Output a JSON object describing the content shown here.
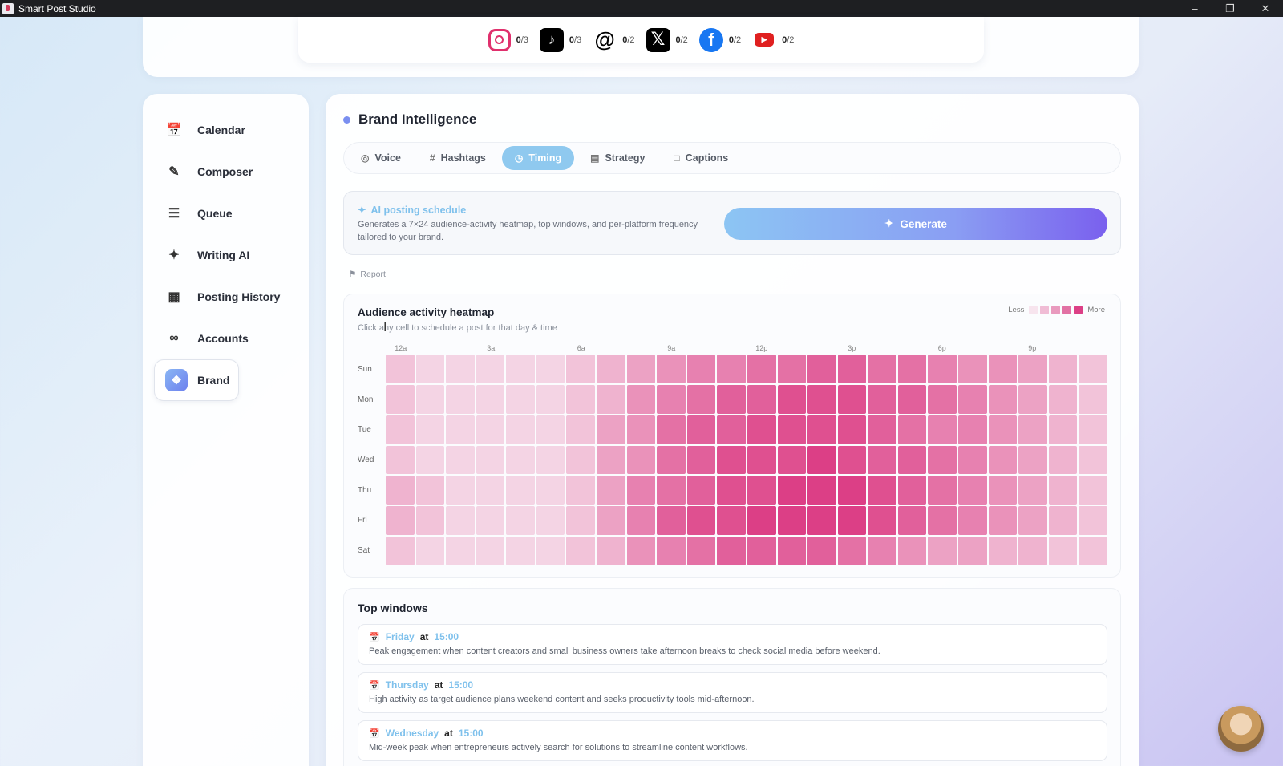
{
  "window": {
    "title": "Smart Post Studio"
  },
  "platforms": [
    {
      "name": "Instagram",
      "icon": "instagram-icon",
      "used": "0",
      "limit": "/3"
    },
    {
      "name": "TikTok",
      "icon": "tiktok-icon",
      "used": "0",
      "limit": "/3"
    },
    {
      "name": "Threads",
      "icon": "threads-icon",
      "used": "0",
      "limit": "/2"
    },
    {
      "name": "X",
      "icon": "x-icon",
      "used": "0",
      "limit": "/2"
    },
    {
      "name": "Facebook",
      "icon": "facebook-icon",
      "used": "0",
      "limit": "/2"
    },
    {
      "name": "YouTube",
      "icon": "youtube-icon",
      "used": "0",
      "limit": "/2"
    }
  ],
  "sidebar": {
    "items": [
      {
        "label": "Calendar",
        "icon": "calendar-icon"
      },
      {
        "label": "Composer",
        "icon": "pen-icon"
      },
      {
        "label": "Queue",
        "icon": "checklist-icon"
      },
      {
        "label": "Writing AI",
        "icon": "sparkles-icon"
      },
      {
        "label": "Posting History",
        "icon": "bar-chart-icon"
      },
      {
        "label": "Accounts",
        "icon": "link-icon"
      },
      {
        "label": "Brand",
        "icon": "compass-icon",
        "active": true
      }
    ]
  },
  "main": {
    "title": "Brand Intelligence",
    "tabs": [
      {
        "label": "Voice",
        "icon": "mic-icon"
      },
      {
        "label": "Hashtags",
        "icon": "hash-icon"
      },
      {
        "label": "Timing",
        "icon": "clock-icon",
        "active": true
      },
      {
        "label": "Strategy",
        "icon": "map-icon"
      },
      {
        "label": "Captions",
        "icon": "chat-icon"
      }
    ],
    "ai_schedule": {
      "title": "AI posting schedule",
      "description": "Generates a 7×24 audience-activity heatmap, top windows, and per-platform frequency tailored to your brand.",
      "button": "Generate"
    },
    "report_label": "Report",
    "heatmap": {
      "title": "Audience activity heatmap",
      "subtitle": "Click any cell to schedule a post for that day & time",
      "legend_less": "Less",
      "legend_more": "More",
      "hour_labels": [
        "12a",
        "3a",
        "6a",
        "9a",
        "12p",
        "3p",
        "6p",
        "9p"
      ],
      "days": [
        "Sun",
        "Mon",
        "Tue",
        "Wed",
        "Thu",
        "Fri",
        "Sat"
      ],
      "levels": [
        [
          0.2,
          0.1,
          0.1,
          0.1,
          0.1,
          0.1,
          0.2,
          0.3,
          0.4,
          0.5,
          0.6,
          0.6,
          0.7,
          0.7,
          0.8,
          0.8,
          0.7,
          0.7,
          0.6,
          0.5,
          0.5,
          0.4,
          0.3,
          0.2
        ],
        [
          0.2,
          0.1,
          0.1,
          0.1,
          0.1,
          0.1,
          0.2,
          0.3,
          0.5,
          0.6,
          0.7,
          0.8,
          0.8,
          0.9,
          0.9,
          0.9,
          0.8,
          0.8,
          0.7,
          0.6,
          0.5,
          0.4,
          0.3,
          0.2
        ],
        [
          0.2,
          0.1,
          0.1,
          0.1,
          0.1,
          0.1,
          0.2,
          0.4,
          0.5,
          0.7,
          0.8,
          0.8,
          0.9,
          0.9,
          0.9,
          0.9,
          0.8,
          0.7,
          0.6,
          0.6,
          0.5,
          0.4,
          0.3,
          0.2
        ],
        [
          0.2,
          0.1,
          0.1,
          0.1,
          0.1,
          0.1,
          0.2,
          0.4,
          0.5,
          0.7,
          0.8,
          0.9,
          0.9,
          0.9,
          1.0,
          0.9,
          0.8,
          0.8,
          0.7,
          0.6,
          0.5,
          0.4,
          0.3,
          0.2
        ],
        [
          0.3,
          0.2,
          0.1,
          0.1,
          0.1,
          0.1,
          0.2,
          0.4,
          0.6,
          0.7,
          0.8,
          0.9,
          0.9,
          1.0,
          1.0,
          1.0,
          0.9,
          0.8,
          0.7,
          0.6,
          0.5,
          0.4,
          0.3,
          0.2
        ],
        [
          0.3,
          0.2,
          0.1,
          0.1,
          0.1,
          0.1,
          0.2,
          0.4,
          0.6,
          0.8,
          0.9,
          0.9,
          1.0,
          1.0,
          1.0,
          1.0,
          0.9,
          0.8,
          0.7,
          0.6,
          0.5,
          0.4,
          0.3,
          0.2
        ],
        [
          0.2,
          0.1,
          0.1,
          0.1,
          0.1,
          0.1,
          0.2,
          0.3,
          0.5,
          0.6,
          0.7,
          0.8,
          0.8,
          0.8,
          0.8,
          0.7,
          0.6,
          0.5,
          0.4,
          0.4,
          0.3,
          0.3,
          0.2,
          0.2
        ]
      ]
    },
    "top_windows": {
      "title": "Top windows",
      "connector": "at",
      "items": [
        {
          "day": "Friday",
          "time": "15:00",
          "description": "Peak engagement when content creators and small business owners take afternoon breaks to check social media before weekend."
        },
        {
          "day": "Thursday",
          "time": "15:00",
          "description": "High activity as target audience plans weekend content and seeks productivity tools mid-afternoon."
        },
        {
          "day": "Wednesday",
          "time": "15:00",
          "description": "Mid-week peak when entrepreneurs actively search for solutions to streamline content workflows."
        }
      ]
    }
  },
  "colors": {
    "accent_blue": "#7fc1ec",
    "heat_low": "#f7e4ee",
    "heat_high": "#dc3f86"
  }
}
